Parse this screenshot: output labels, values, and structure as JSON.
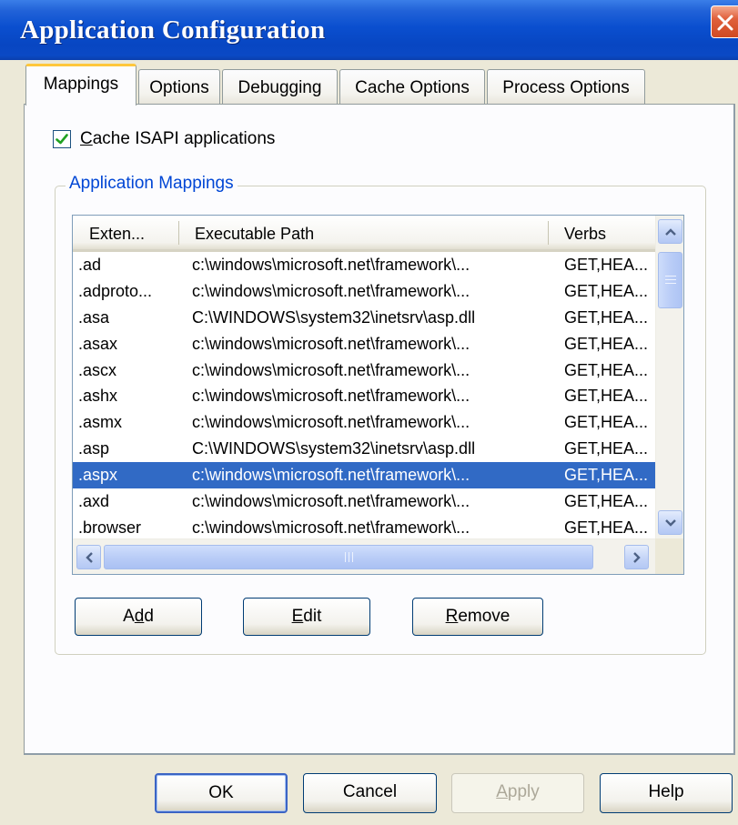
{
  "window": {
    "title": "Application Configuration",
    "close_glyph": "✕"
  },
  "tabs": [
    {
      "label": "Mappings",
      "active": true
    },
    {
      "label": "Options",
      "active": false
    },
    {
      "label": "Debugging",
      "active": false
    },
    {
      "label": "Cache Options",
      "active": false
    },
    {
      "label": "Process Options",
      "active": false
    }
  ],
  "cache_isapi": {
    "label_first": "C",
    "label_rest": "ache ISAPI applications",
    "checked": true
  },
  "mappings_group": {
    "legend": "Application Mappings"
  },
  "list": {
    "columns": [
      "Exten...",
      "Executable Path",
      "Verbs"
    ],
    "rows": [
      {
        "ext": ".ad",
        "path": "c:\\windows\\microsoft.net\\framework\\...",
        "verbs": "GET,HEA..."
      },
      {
        "ext": ".adproto...",
        "path": "c:\\windows\\microsoft.net\\framework\\...",
        "verbs": "GET,HEA..."
      },
      {
        "ext": ".asa",
        "path": "C:\\WINDOWS\\system32\\inetsrv\\asp.dll",
        "verbs": "GET,HEA..."
      },
      {
        "ext": ".asax",
        "path": "c:\\windows\\microsoft.net\\framework\\...",
        "verbs": "GET,HEA..."
      },
      {
        "ext": ".ascx",
        "path": "c:\\windows\\microsoft.net\\framework\\...",
        "verbs": "GET,HEA..."
      },
      {
        "ext": ".ashx",
        "path": "c:\\windows\\microsoft.net\\framework\\...",
        "verbs": "GET,HEA..."
      },
      {
        "ext": ".asmx",
        "path": "c:\\windows\\microsoft.net\\framework\\...",
        "verbs": "GET,HEA..."
      },
      {
        "ext": ".asp",
        "path": "C:\\WINDOWS\\system32\\inetsrv\\asp.dll",
        "verbs": "GET,HEA..."
      },
      {
        "ext": ".aspx",
        "path": "c:\\windows\\microsoft.net\\framework\\...",
        "verbs": "GET,HEA...",
        "selected": true
      },
      {
        "ext": ".axd",
        "path": "c:\\windows\\microsoft.net\\framework\\...",
        "verbs": "GET,HEA..."
      },
      {
        "ext": ".browser",
        "path": "c:\\windows\\microsoft.net\\framework\\...",
        "verbs": "GET,HEA..."
      }
    ],
    "selected_index": 8
  },
  "mapping_buttons": {
    "add": {
      "before": "A",
      "mnemonic": "d",
      "after": "d"
    },
    "edit": {
      "before": "",
      "mnemonic": "E",
      "after": "dit"
    },
    "remove": {
      "before": "",
      "mnemonic": "R",
      "after": "emove"
    }
  },
  "dialog_buttons": {
    "ok": "OK",
    "cancel": "Cancel",
    "apply": {
      "before": "",
      "mnemonic": "A",
      "after": "pply",
      "enabled": false
    },
    "help": "Help"
  },
  "colors": {
    "titlebar": "#0a4fcf",
    "selection": "#316ac5",
    "group_legend": "#0046d5",
    "active_tab_accent": "#ffc73c",
    "dialog_face": "#ece9d8"
  },
  "icons": {
    "close": "close-icon",
    "check": "checkmark-icon",
    "scroll_up": "chevron-up-icon",
    "scroll_down": "chevron-down-icon",
    "scroll_left": "chevron-left-icon",
    "scroll_right": "chevron-right-icon"
  }
}
